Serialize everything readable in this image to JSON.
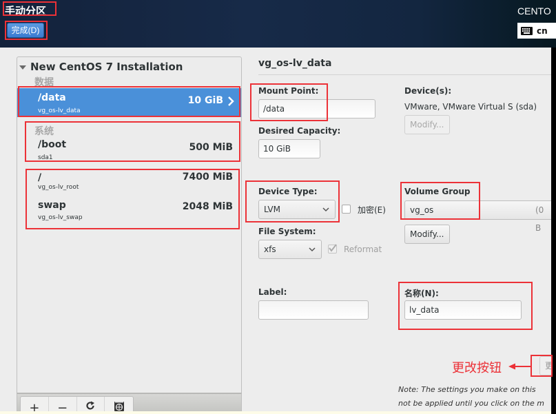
{
  "header": {
    "spoke_title": "手动分区",
    "done_button": "完成(D)",
    "distro": "CENTO",
    "keyboard_layout": "cn"
  },
  "partitions": {
    "installation_title": "New CentOS 7 Installation",
    "groups": [
      {
        "label": "数据",
        "items": [
          {
            "mount": "/data",
            "device": "vg_os-lv_data",
            "size": "10 GiB",
            "selected": true
          }
        ]
      },
      {
        "label": "系统",
        "items": [
          {
            "mount": "/boot",
            "device": "sda1",
            "size": "500 MiB",
            "selected": false
          },
          {
            "mount": "/",
            "device": "vg_os-lv_root",
            "size": "7400 MiB",
            "selected": false
          },
          {
            "mount": "swap",
            "device": "vg_os-lv_swap",
            "size": "2048 MiB",
            "selected": false
          }
        ]
      }
    ],
    "toolbar": {
      "add": "+",
      "remove": "−",
      "refresh": "↻",
      "configure": "config"
    }
  },
  "details": {
    "title": "vg_os-lv_data",
    "mount_point_label": "Mount Point:",
    "mount_point_value": "/data",
    "desired_capacity_label": "Desired Capacity:",
    "desired_capacity_value": "10 GiB",
    "devices_label": "Device(s):",
    "devices_value": "VMware, VMware Virtual S (sda)",
    "devices_modify": "Modify...",
    "device_type_label": "Device Type:",
    "device_type_value": "LVM",
    "encrypt_label": "加密(E)",
    "encrypt_checked": false,
    "file_system_label": "File System:",
    "file_system_value": "xfs",
    "reformat_label": "Reformat",
    "reformat_checked": true,
    "volume_group_label": "Volume Group",
    "volume_group_value": "vg_os",
    "volume_group_free": "(0 B",
    "volume_group_modify": "Modify...",
    "label_label": "Label:",
    "label_value": "",
    "name_label": "名称(N):",
    "name_value": "lv_data",
    "update_button": "更",
    "note_line1": "Note:  The settings you make on this",
    "note_line2": "not be applied until you click on the m"
  },
  "annotation": {
    "text": "更改按钮",
    "color": "#ec3137"
  },
  "colors": {
    "selected_row": "#4a90d9",
    "header_bg": "#172a48",
    "panel_bg": "#ededed"
  }
}
